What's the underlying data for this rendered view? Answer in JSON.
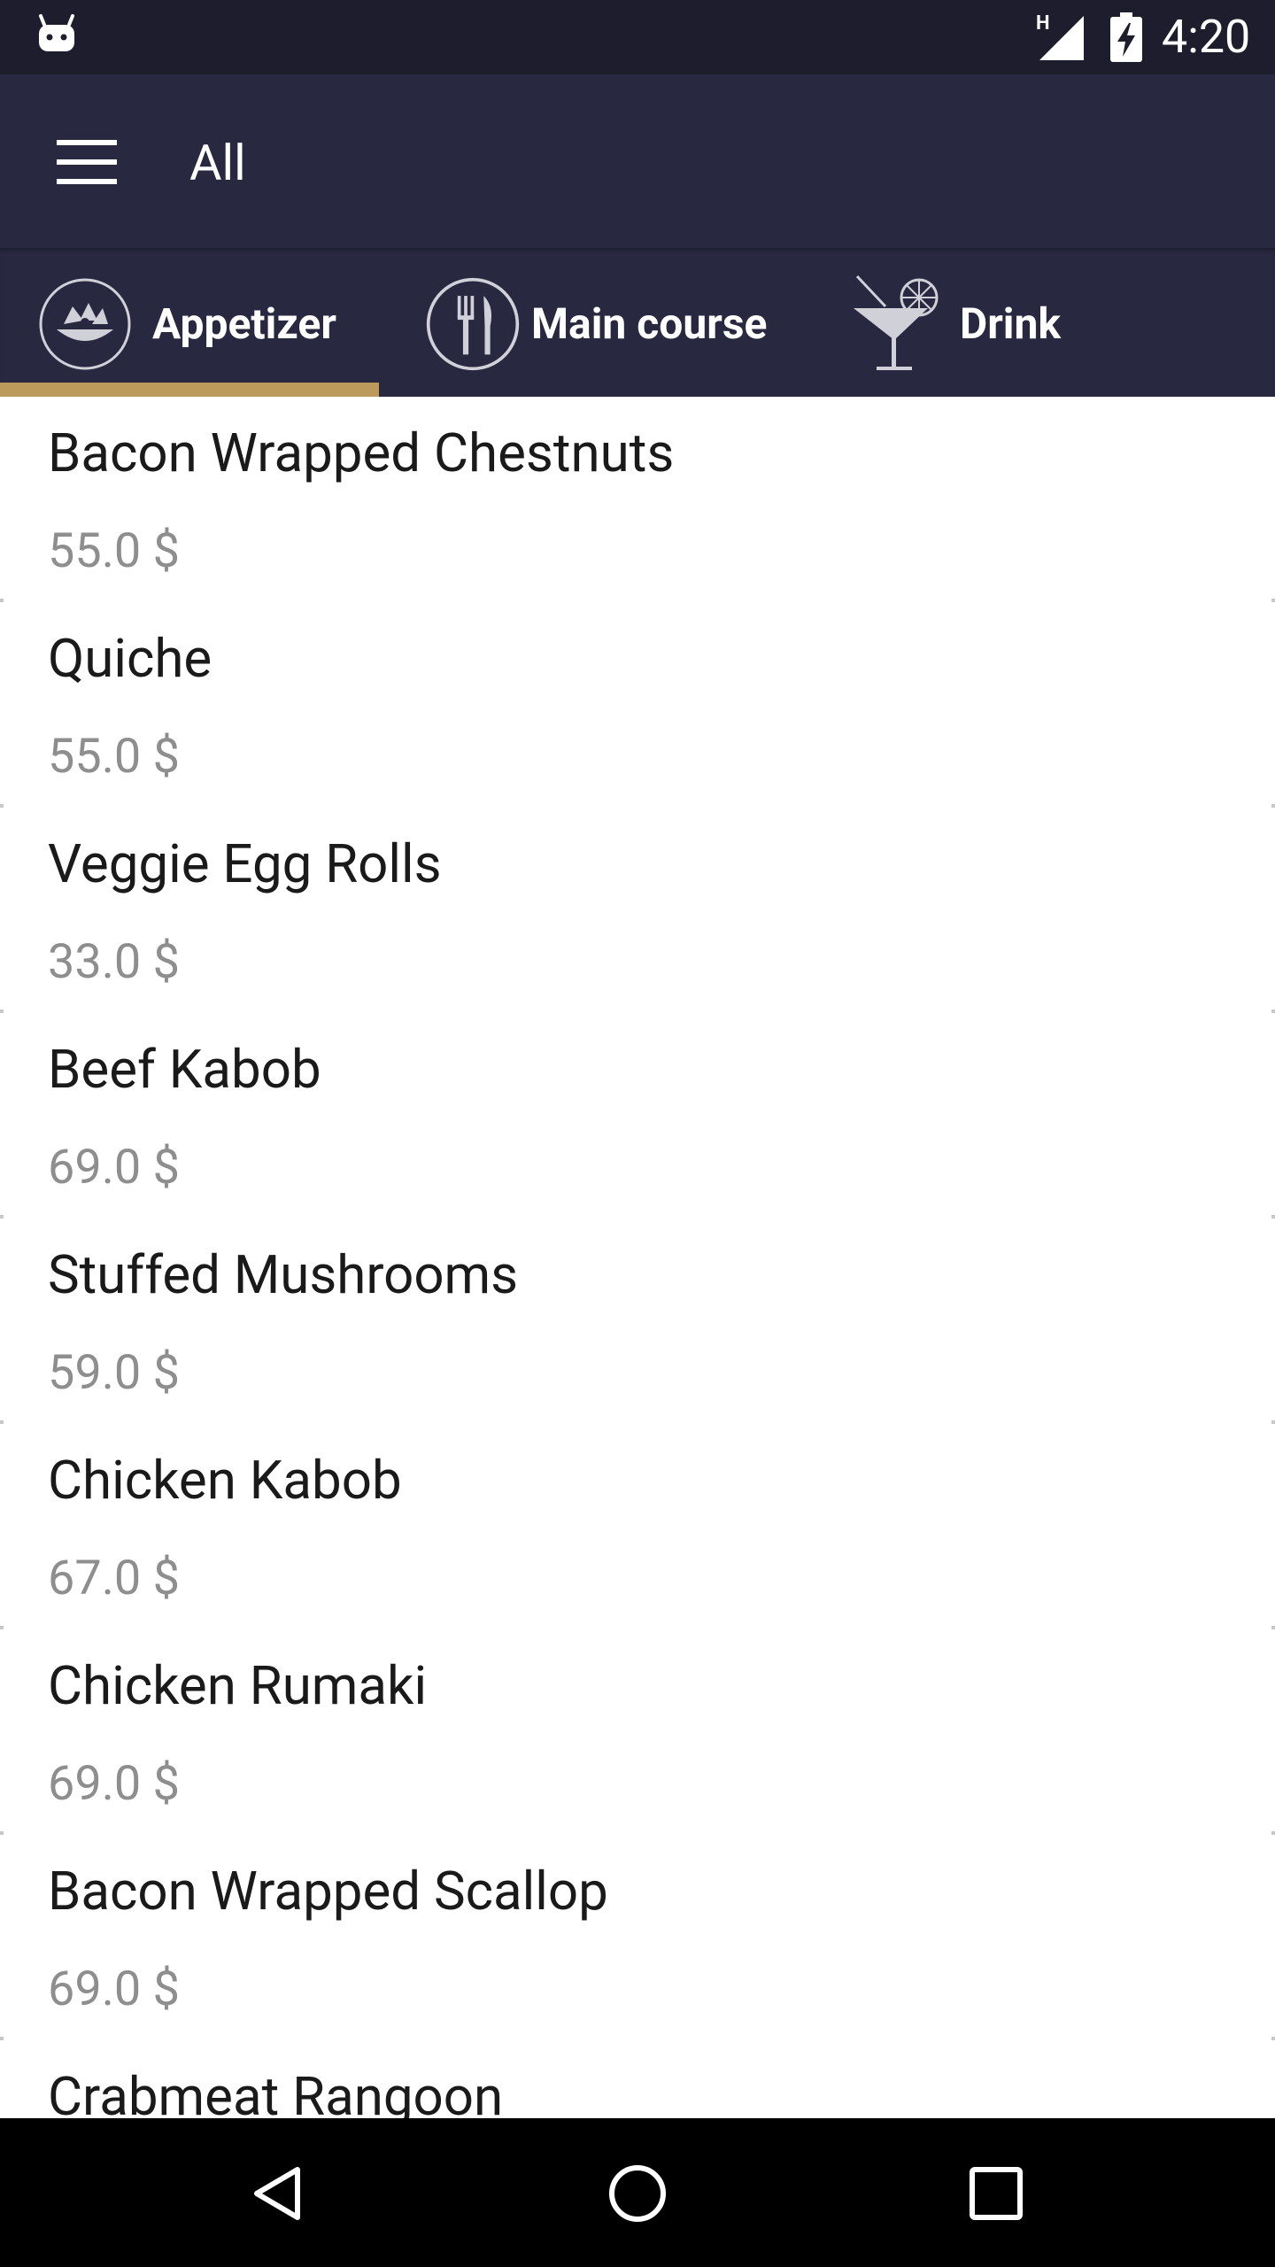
{
  "status_bar": {
    "network_type": "H",
    "clock": "4:20",
    "icons": [
      "android-icon",
      "signal-icon",
      "battery-charging-icon"
    ]
  },
  "app_bar": {
    "title": "All",
    "menu_icon": "hamburger-menu-icon"
  },
  "tabs": [
    {
      "label": "Appetizer",
      "icon": "appetizer-plate-icon",
      "selected": true
    },
    {
      "label": "Main course",
      "icon": "fork-knife-icon",
      "selected": false
    },
    {
      "label": "Drink",
      "icon": "cocktail-icon",
      "selected": false
    }
  ],
  "colors": {
    "status_bar_bg": "#1d1d2e",
    "app_bar_bg": "#292841",
    "tab_indicator": "#bb9a5c",
    "price_text": "#8e8e8e"
  },
  "menu_items": [
    {
      "name": "Bacon Wrapped Chestnuts",
      "price": "55.0 $"
    },
    {
      "name": "Quiche",
      "price": "55.0 $"
    },
    {
      "name": "Veggie Egg Rolls",
      "price": "33.0 $"
    },
    {
      "name": "Beef Kabob",
      "price": "69.0 $"
    },
    {
      "name": "Stuffed Mushrooms",
      "price": "59.0 $"
    },
    {
      "name": "Chicken Kabob",
      "price": "67.0 $"
    },
    {
      "name": "Chicken Rumaki",
      "price": "69.0 $"
    },
    {
      "name": "Bacon Wrapped Scallop",
      "price": "69.0 $"
    },
    {
      "name": "Crabmeat Rangoon",
      "price": ""
    }
  ],
  "nav_bar": {
    "buttons": [
      "back-icon",
      "home-icon",
      "recents-icon"
    ]
  }
}
